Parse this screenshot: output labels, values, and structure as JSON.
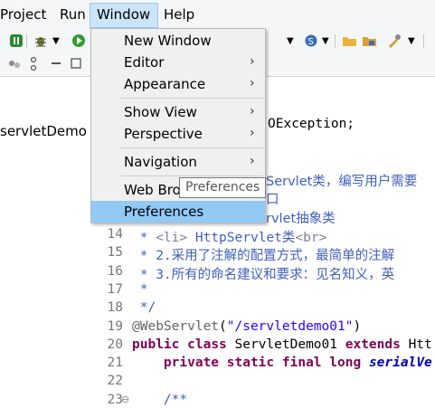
{
  "menubar": {
    "items": [
      "Project",
      "Run",
      "Window",
      "Help"
    ]
  },
  "left_panel": {
    "project_label": "servletDemo"
  },
  "dropdown": {
    "items": [
      {
        "label": "New Window",
        "submenu": false
      },
      {
        "label": "Editor",
        "submenu": true
      },
      {
        "label": "Appearance",
        "submenu": true
      },
      {
        "label": "Show View",
        "submenu": true
      },
      {
        "label": "Perspective",
        "submenu": true
      },
      {
        "label": "Navigation",
        "submenu": true
      },
      {
        "label": "Web Bro",
        "submenu": false
      },
      {
        "label": "Preferences",
        "submenu": false
      }
    ],
    "arrow": "›",
    "highlighted": "Preferences"
  },
  "tooltip": {
    "text": "Preferences"
  },
  "editor": {
    "partial_lines": {
      "exception": "OException;",
      "servlet_desc": "Servlet类，编写用户需要",
      "kou": "口",
      "abstract": "rvlet抽象类"
    },
    "lines": [
      {
        "num": "14",
        "parts": [
          [
            " * ",
            "cmt"
          ],
          [
            "<li>",
            "tag"
          ],
          [
            " HttpServlet类",
            "cmt"
          ],
          [
            "<br>",
            "tag"
          ]
        ]
      },
      {
        "num": "15",
        "parts": [
          [
            " * 2.采用了注解的配置方式，最简单的注解",
            "cmt"
          ]
        ]
      },
      {
        "num": "16",
        "parts": [
          [
            " * 3.所有的命名建议和要求：见名知义，英",
            "cmt"
          ]
        ]
      },
      {
        "num": "17",
        "parts": [
          [
            " *",
            "cmt"
          ]
        ]
      },
      {
        "num": "18",
        "parts": [
          [
            " */",
            "cmt"
          ]
        ]
      },
      {
        "num": "19",
        "parts": [
          [
            "@WebServlet",
            "ann"
          ],
          [
            "(",
            "plain"
          ],
          [
            "\"/servletdemo01\"",
            "str"
          ],
          [
            ")",
            "plain"
          ]
        ]
      },
      {
        "num": "20",
        "parts": [
          [
            "public",
            "kw"
          ],
          [
            " ",
            "plain"
          ],
          [
            "class",
            "kw"
          ],
          [
            " ServletDemo01 ",
            "plain"
          ],
          [
            "extends",
            "kw"
          ],
          [
            " Htt",
            "plain"
          ]
        ]
      },
      {
        "num": "21",
        "parts": [
          [
            "    ",
            "plain"
          ],
          [
            "private",
            "kw"
          ],
          [
            " ",
            "plain"
          ],
          [
            "static",
            "kw"
          ],
          [
            " ",
            "plain"
          ],
          [
            "final",
            "kw"
          ],
          [
            " ",
            "plain"
          ],
          [
            "long",
            "kw"
          ],
          [
            " ",
            "plain"
          ],
          [
            "serialVe",
            "it"
          ]
        ]
      },
      {
        "num": "22",
        "parts": []
      },
      {
        "num": "23",
        "parts": [
          [
            "    ",
            "plain"
          ],
          [
            "/**",
            "cmt"
          ]
        ]
      }
    ],
    "fold_marker": "⊖"
  },
  "colors": {
    "menubar_bg": "#f5f6f7",
    "selected_menu_bg": "#cce4f7",
    "highlight_bg": "#91c9f7",
    "comment": "#3f5fbf",
    "keyword": "#7f0055",
    "string": "#2a00ff"
  },
  "icons": [
    "run-debug-icon",
    "debug-bug-icon",
    "run-icon",
    "open-folder-icon",
    "web-service-icon",
    "tools-icon",
    "collapse-icon",
    "minimize-icon",
    "maximize-icon"
  ]
}
